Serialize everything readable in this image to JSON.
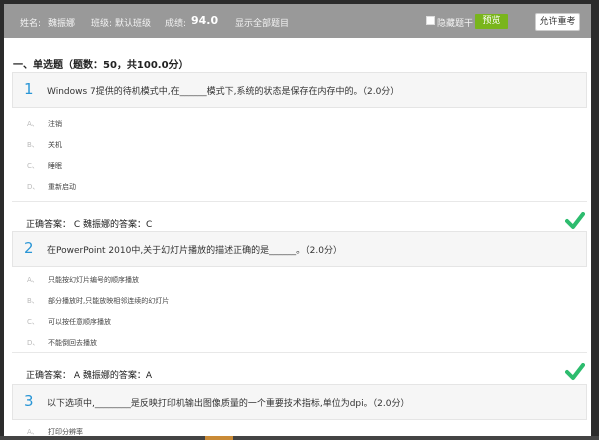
{
  "header": {
    "name_label": "姓名:",
    "name_value": "魏振娜",
    "class_label": "班级:",
    "class_value": "默认班级",
    "score_label": "成绩:",
    "score_value": "94.0",
    "show_all": "显示全部题目",
    "hide_stem_label": "隐藏题干",
    "preview_label": "预览",
    "redo_label": "允许重考"
  },
  "section": {
    "title": "一、单选题（题数：50，共100.0分）"
  },
  "questions": [
    {
      "number": "1",
      "text": "Windows 7提供的待机模式中,在______模式下,系统的状态是保存在内存中的。（2.0分）",
      "options": [
        {
          "letter": "A、",
          "text": "注销"
        },
        {
          "letter": "B、",
          "text": "关机"
        },
        {
          "letter": "C、",
          "text": "睡眠"
        },
        {
          "letter": "D、",
          "text": "重新启动"
        }
      ],
      "answer": "正确答案：  C 魏振娜的答案：C"
    },
    {
      "number": "2",
      "text": "在PowerPoint 2010中,关于幻灯片播放的描述正确的是______。（2.0分）",
      "options": [
        {
          "letter": "A、",
          "text": "只能按幻灯片编号的顺序播放"
        },
        {
          "letter": "B、",
          "text": "部分播放时,只能放映相邻连续的幻灯片"
        },
        {
          "letter": "C、",
          "text": "可以按任意顺序播放"
        },
        {
          "letter": "D、",
          "text": "不能倒回去播放"
        }
      ],
      "answer": "正确答案：  A 魏振娜的答案：A"
    },
    {
      "number": "3",
      "text": "以下选项中,________是反映打印机输出图像质量的一个重要技术指标,单位为dpi。（2.0分）",
      "options": [
        {
          "letter": "A、",
          "text": "打印分辨率"
        }
      ]
    }
  ],
  "colors": {
    "accent_blue": "#2a96d6",
    "check_green": "#2dbc6e",
    "preview_green": "#79b51c",
    "topbar_gray": "#999999"
  }
}
